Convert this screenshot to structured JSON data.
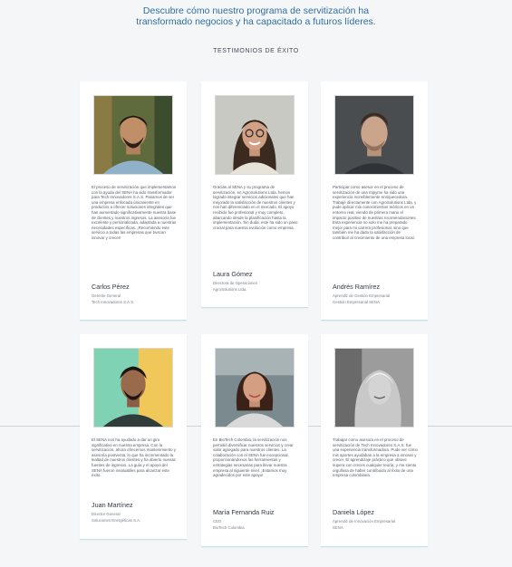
{
  "header": {
    "title": "Descubre cómo nuestro programa de servitización ha transformado negocios y ha capacitado a futuros líderes.",
    "section_label": "TESTIMONIOS DE ÉXITO"
  },
  "testimonials": [
    {
      "quote": "El proceso de servitización que implementamos con la ayuda del SENA ha sido transformador para Tech Innovadores S.A.S. Pasamos de ser una empresa enfocada únicamente en productos a ofrecer soluciones integrales que han aumentado significativamente nuestra base de clientes y nuestros ingresos. La asesoría fue excelente y personalizada, adaptada a nuestras necesidades específicas. ¡Recomiendo este servicio a todas las empresas que buscan innovar y crecer!",
      "name": "Carlos Pérez",
      "role": "Gerente General",
      "company": "Tech Innovadores S.A.S."
    },
    {
      "quote": "Gracias al SENA y su programa de servitización, en AgroSolutions Ltda. hemos logrado integrar servicios adicionales que han mejorado la satisfacción de nuestros clientes y nos han diferenciado en el mercado. El apoyo recibido fue profesional y muy completo, abarcando desde la planificación hasta la implementación. Sin duda, este ha sido un paso crucial para nuestra evolución como empresa.",
      "name": "Laura Gómez",
      "role": "Directora de Operaciones",
      "company": "AgroSolutions Ltda."
    },
    {
      "quote": "Participar como asesor en el proceso de servitización de una mipyme ha sido una experiencia increíblemente enriquecedora. Trabajé directamente con AgroSolutions Ltda. y pude aplicar mis conocimientos teóricos en un entorno real, viendo de primera mano el impacto positivo de nuestras recomendaciones. Esta experiencia no solo me ha preparado mejor para mi carrera profesional, sino que también me ha dado la satisfacción de contribuir al crecimiento de una empresa local.",
      "name": "Andrés Ramírez",
      "role": "Aprendiz de Gestión Empresarial",
      "company": "Gestión Empresarial SENA"
    },
    {
      "quote": "El SENA nos ha ayudado a dar un giro significativo en nuestra empresa. Con la servitización, ahora ofrecemos mantenimiento y asesoría postventa, lo que ha incrementado la lealtad de nuestros clientes y ha abierto nuevas fuentes de ingresos. La guía y el apoyo del SENA fueron invaluables para alcanzar este éxito.",
      "name": "Juan Martínez",
      "role": "Director General",
      "company": "Soluciones Energéticas S.A."
    },
    {
      "quote": "En BioTech Colombia, la servitización nos permitió diversificar nuestros servicios y crear valor agregado para nuestros clientes. La colaboración con el SENA fue excepcional, proporcionándonos las herramientas y estrategias necesarias para llevar nuestra empresa al siguiente nivel. ¡Estamos muy agradecidos por este apoyo!",
      "name": "María Fernanda Ruiz",
      "role": "CEO",
      "company": "BioTech Colombia"
    },
    {
      "quote": "Trabajar como asesora en el proceso de servitización de Tech Innovadores S.A.S. fue una experiencia transformadora. Pude ver cómo mis aportes ayudaban a la empresa a innovar y crecer. El aprendizaje práctico que obtuve supera con creces cualquier teoría, y me siento orgullosa de haber contribuido al éxito de una empresa colombiana.",
      "name": "Daniela López",
      "role": "Aprendiz de Innovación Empresarial",
      "company": "SENA"
    }
  ],
  "colors": {
    "title": "#2c6f9e",
    "background": "#f5f6f8",
    "card_accent": "#bfe3ee"
  }
}
